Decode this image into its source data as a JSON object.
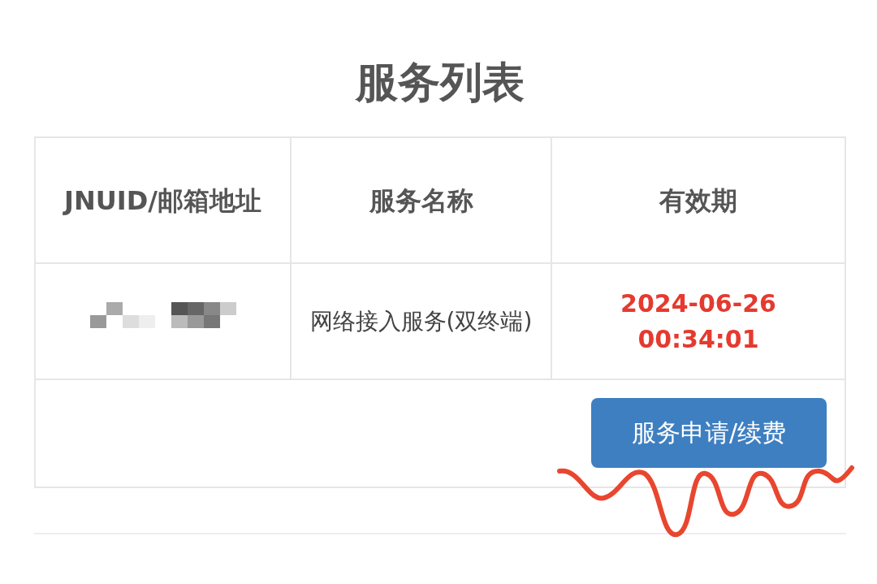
{
  "title": "服务列表",
  "table": {
    "columns": [
      "JNUID/邮箱地址",
      "服务名称",
      "有效期"
    ],
    "rows": [
      {
        "account": {
          "kind": "redacted"
        },
        "service": "网络接入服务(双终端)",
        "expiry": "2024-06-26 00:34:01"
      }
    ]
  },
  "action_button": "服务申请/续费"
}
